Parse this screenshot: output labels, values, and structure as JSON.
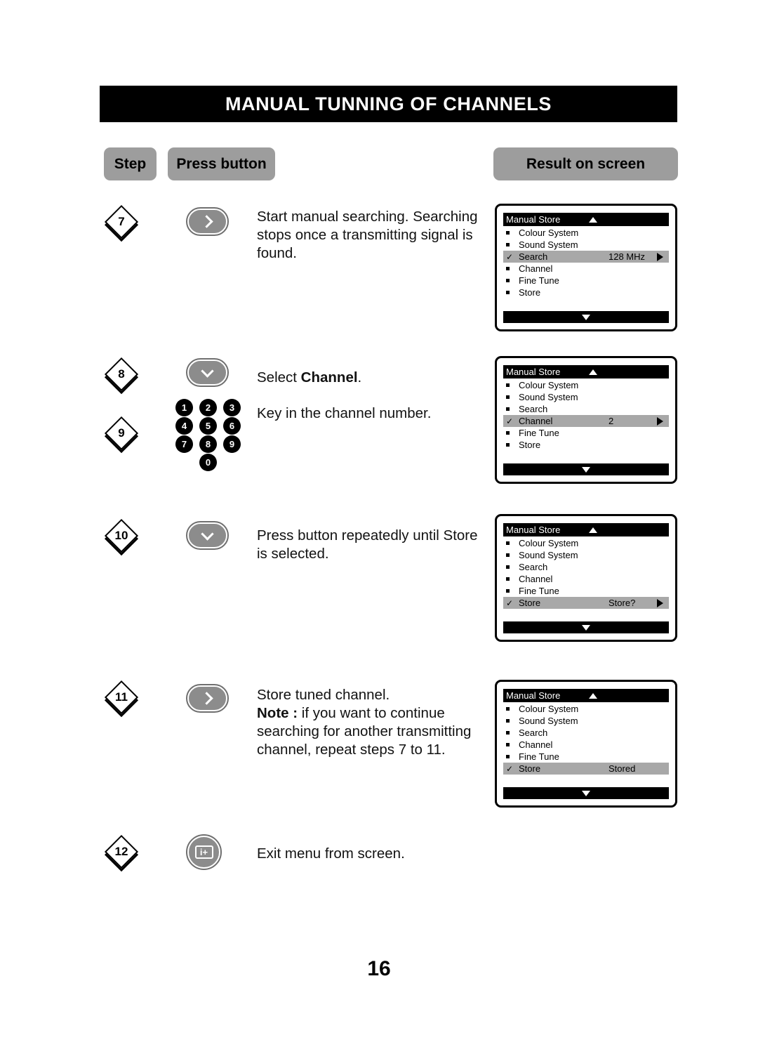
{
  "header": {
    "title": "MANUAL TUNNING OF CHANNELS"
  },
  "columns": {
    "step_label": "Step",
    "press_button_label": "Press button",
    "result_label": "Result on screen"
  },
  "steps": [
    {
      "number": "7",
      "button": {
        "type": "pill",
        "icon": "chevron-right-icon"
      },
      "text_html": "Start manual searching. Searching stops once a transmitting signal is found.",
      "screen": {
        "title": "Manual Store",
        "items": [
          {
            "label": "Colour System",
            "marker": "bullet",
            "value": "",
            "arrow": false,
            "selected": false
          },
          {
            "label": "Sound System",
            "marker": "bullet",
            "value": "",
            "arrow": false,
            "selected": false
          },
          {
            "label": "Search",
            "marker": "check",
            "value": "128 MHz",
            "arrow": true,
            "selected": true
          },
          {
            "label": "Channel",
            "marker": "bullet",
            "value": "",
            "arrow": false,
            "selected": false
          },
          {
            "label": "Fine Tune",
            "marker": "bullet",
            "value": "",
            "arrow": false,
            "selected": false
          },
          {
            "label": "Store",
            "marker": "bullet",
            "value": "",
            "arrow": false,
            "selected": false
          }
        ]
      }
    },
    {
      "number": "8",
      "button": {
        "type": "pill",
        "icon": "chevron-down-icon"
      },
      "text_html": "Select <b>Channel</b>.",
      "screen": null
    },
    {
      "number": "9",
      "button": {
        "type": "keypad",
        "keys": [
          "1",
          "2",
          "3",
          "4",
          "5",
          "6",
          "7",
          "8",
          "9",
          "0"
        ]
      },
      "text_html": "Key in the channel number.",
      "screen": {
        "title": "Manual Store",
        "items": [
          {
            "label": "Colour System",
            "marker": "bullet",
            "value": "",
            "arrow": false,
            "selected": false
          },
          {
            "label": "Sound System",
            "marker": "bullet",
            "value": "",
            "arrow": false,
            "selected": false
          },
          {
            "label": "Search",
            "marker": "bullet",
            "value": "",
            "arrow": false,
            "selected": false
          },
          {
            "label": "Channel",
            "marker": "check",
            "value": "2",
            "arrow": true,
            "selected": true
          },
          {
            "label": "Fine Tune",
            "marker": "bullet",
            "value": "",
            "arrow": false,
            "selected": false
          },
          {
            "label": "Store",
            "marker": "bullet",
            "value": "",
            "arrow": false,
            "selected": false
          }
        ]
      }
    },
    {
      "number": "10",
      "button": {
        "type": "pill",
        "icon": "chevron-down-icon"
      },
      "text_html": "Press button repeatedly until Store is selected.",
      "screen": {
        "title": "Manual Store",
        "items": [
          {
            "label": "Colour System",
            "marker": "bullet",
            "value": "",
            "arrow": false,
            "selected": false
          },
          {
            "label": "Sound System",
            "marker": "bullet",
            "value": "",
            "arrow": false,
            "selected": false
          },
          {
            "label": "Search",
            "marker": "bullet",
            "value": "",
            "arrow": false,
            "selected": false
          },
          {
            "label": "Channel",
            "marker": "bullet",
            "value": "",
            "arrow": false,
            "selected": false
          },
          {
            "label": "Fine Tune",
            "marker": "bullet",
            "value": "",
            "arrow": false,
            "selected": false
          },
          {
            "label": "Store",
            "marker": "check",
            "value": "Store?",
            "arrow": true,
            "selected": true
          }
        ]
      }
    },
    {
      "number": "11",
      "button": {
        "type": "pill",
        "icon": "chevron-right-icon"
      },
      "text_html": "Store tuned channel.<br><b>Note :</b> if you want to continue searching for another transmitting channel, repeat steps 7 to 11.",
      "screen": {
        "title": "Manual Store",
        "items": [
          {
            "label": "Colour System",
            "marker": "bullet",
            "value": "",
            "arrow": false,
            "selected": false
          },
          {
            "label": "Sound System",
            "marker": "bullet",
            "value": "",
            "arrow": false,
            "selected": false
          },
          {
            "label": "Search",
            "marker": "bullet",
            "value": "",
            "arrow": false,
            "selected": false
          },
          {
            "label": "Channel",
            "marker": "bullet",
            "value": "",
            "arrow": false,
            "selected": false
          },
          {
            "label": "Fine Tune",
            "marker": "bullet",
            "value": "",
            "arrow": false,
            "selected": false
          },
          {
            "label": "Store",
            "marker": "check",
            "value": "Stored",
            "arrow": false,
            "selected": true
          }
        ]
      }
    },
    {
      "number": "12",
      "button": {
        "type": "round",
        "icon": "info-plus-icon",
        "glyph": "i+"
      },
      "text_html": "Exit menu from screen.",
      "screen": null
    }
  ],
  "footer": {
    "page_number": "16"
  },
  "colors": {
    "pill_gray": "#9d9d9d",
    "button_gray": "#8c8c8c",
    "highlight_gray": "#a8a8a8",
    "bar_black": "#000000"
  }
}
